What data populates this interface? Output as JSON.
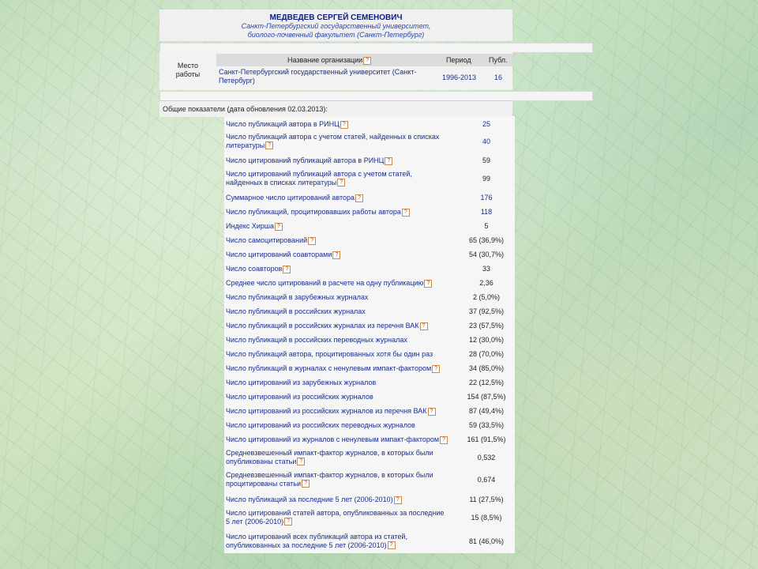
{
  "author": {
    "name": "МЕДВЕДЕВ СЕРГЕЙ СЕМЕНОВИЧ",
    "affiliation_line1": "Санкт-Петербургский государственный университет,",
    "affiliation_line2": "биолого-почвенный факультет (Санкт-Петербург)"
  },
  "work": {
    "label_line1": "Место",
    "label_line2": "работы",
    "columns": {
      "org": "Название организации",
      "period": "Период",
      "pub": "Публ."
    },
    "rows": [
      {
        "org_line1": "Санкт-Петербургский государственный университет (Санкт-",
        "org_line2": "Петербург)",
        "period": "1996-2013",
        "pub": "16"
      }
    ]
  },
  "general": {
    "label": "Общие показатели (дата обновления 02.03.2013):"
  },
  "metrics": [
    {
      "l1": "Число публикаций автора в РИНЦ",
      "l2": "",
      "help": true,
      "value": "25",
      "link": true
    },
    {
      "l1": "Число публикаций автора с учетом статей, найденных в списках",
      "l2": "литературы",
      "help": true,
      "value": "40",
      "link": true
    },
    {
      "l1": "Число цитирований публикаций автора в РИНЦ",
      "l2": "",
      "help": true,
      "value": "59",
      "link": false
    },
    {
      "l1": "Число цитирований публикаций автора с учетом статей,",
      "l2": "найденных в списках литературы",
      "help": true,
      "value": "99",
      "link": false
    },
    {
      "l1": "Суммарное число цитирований автора",
      "l2": "",
      "help": true,
      "value": "176",
      "link": true
    },
    {
      "l1": "Число публикаций, процитировавших работы автора",
      "l2": "",
      "help": true,
      "value": "118",
      "link": true
    },
    {
      "l1": "Индекс Хирша",
      "l2": "",
      "help": true,
      "value": "5",
      "link": false
    },
    {
      "l1": "Число самоцитирований",
      "l2": "",
      "help": true,
      "value": "65 (36,9%)",
      "link": false
    },
    {
      "l1": "Число цитирований соавторами",
      "l2": "",
      "help": true,
      "value": "54 (30,7%)",
      "link": false
    },
    {
      "l1": "Число соавторов",
      "l2": "",
      "help": true,
      "value": "33",
      "link": false
    },
    {
      "l1": "Среднее число цитирований в расчете на одну публикацию",
      "l2": "",
      "help": true,
      "value": "2,36",
      "link": false
    },
    {
      "l1": "Число публикаций в зарубежных журналах",
      "l2": "",
      "help": false,
      "value": "2 (5,0%)",
      "link": false
    },
    {
      "l1": "Число публикаций в российских журналах",
      "l2": "",
      "help": false,
      "value": "37 (92,5%)",
      "link": false
    },
    {
      "l1": "Число публикаций в российских журналах из перечня ВАК",
      "l2": "",
      "help": true,
      "value": "23 (57,5%)",
      "link": false
    },
    {
      "l1": "Число публикаций в российских переводных журналах",
      "l2": "",
      "help": false,
      "value": "12 (30,0%)",
      "link": false
    },
    {
      "l1": "Число публикаций автора, процитированных хотя бы один раз",
      "l2": "",
      "help": false,
      "value": "28 (70,0%)",
      "link": false
    },
    {
      "l1": "Число публикаций в журналах с ненулевым импакт-фактором",
      "l2": "",
      "help": true,
      "value": "34 (85,0%)",
      "link": false
    },
    {
      "l1": "Число цитирований из зарубежных журналов",
      "l2": "",
      "help": false,
      "value": "22 (12,5%)",
      "link": false
    },
    {
      "l1": "Число цитирований из российских журналов",
      "l2": "",
      "help": false,
      "value": "154 (87,5%)",
      "link": false
    },
    {
      "l1": "Число цитирований из российских журналов из перечня ВАК",
      "l2": "",
      "help": true,
      "value": "87 (49,4%)",
      "link": false
    },
    {
      "l1": "Число цитирований из российских переводных журналов",
      "l2": "",
      "help": false,
      "value": "59 (33,5%)",
      "link": false
    },
    {
      "l1": "Число цитирований из журналов с ненулевым импакт-фактором",
      "l2": "",
      "help": true,
      "value": "161 (91,5%)",
      "link": false
    },
    {
      "l1": "Средневзвешенный импакт-фактор журналов, в которых были",
      "l2": "опубликованы статьи",
      "help": true,
      "value": "0,532",
      "link": false
    },
    {
      "l1": "Средневзвешенный импакт-фактор журналов, в которых были",
      "l2": "процитированы статьи",
      "help": true,
      "value": "0,674",
      "link": false
    },
    {
      "l1": "Число публикаций за последние 5 лет (2006-2010)",
      "l2": "",
      "help": true,
      "value": "11 (27,5%)",
      "link": false
    },
    {
      "l1": "Число цитирований статей автора, опубликованных за последние",
      "l2": "5 лет (2006-2010)",
      "help": true,
      "value": "15 (8,5%)",
      "link": false
    },
    {
      "l1": "Число цитирований всех публикаций автора из статей,",
      "l2": "опубликованных за последние 5 лет (2006-2010)",
      "help": true,
      "value": "81 (46,0%)",
      "link": false
    }
  ],
  "ui": {
    "help_glyph": "?"
  }
}
